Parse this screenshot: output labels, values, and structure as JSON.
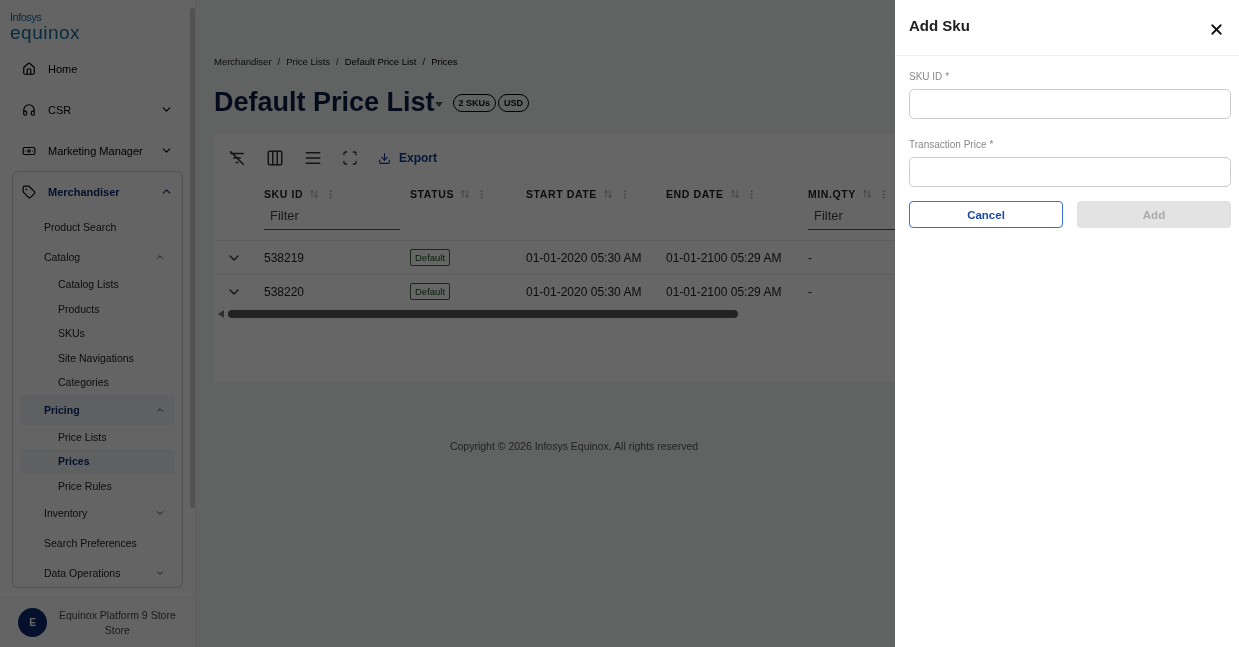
{
  "logo": {
    "top": "Infosys",
    "bottom": "equinox"
  },
  "sidebar": {
    "items": [
      {
        "label": "Home",
        "selected": false
      },
      {
        "label": "CSR",
        "expanded": false,
        "selected": false
      },
      {
        "label": "Marketing Manager",
        "expanded": false,
        "selected": false
      },
      {
        "label": "Merchandiser",
        "expanded": true,
        "selected": true,
        "children": [
          {
            "label": "Product Search",
            "selected": false
          },
          {
            "label": "Catalog",
            "expanded": true,
            "selected": false,
            "children": [
              {
                "label": "Catalog Lists",
                "selected": false
              },
              {
                "label": "Products",
                "selected": false
              },
              {
                "label": "SKUs",
                "selected": false
              },
              {
                "label": "Site Navigations",
                "selected": false
              },
              {
                "label": "Categories",
                "selected": false
              }
            ]
          },
          {
            "label": "Pricing",
            "expanded": true,
            "selected": true,
            "children": [
              {
                "label": "Price Lists",
                "selected": false
              },
              {
                "label": "Prices",
                "selected": true
              },
              {
                "label": "Price Rules",
                "selected": false
              }
            ]
          },
          {
            "label": "Inventory",
            "expanded": false,
            "selected": false
          },
          {
            "label": "Search Preferences",
            "selected": false
          },
          {
            "label": "Data Operations",
            "expanded": false,
            "selected": false
          }
        ]
      }
    ],
    "footer": {
      "avatar": "E",
      "name": "Equinox Platform 9 Store",
      "role": "Store"
    }
  },
  "breadcrumb": [
    {
      "kind": "link",
      "label": "Merchandiser"
    },
    {
      "kind": "separator",
      "label": "/"
    },
    {
      "kind": "link",
      "label": "Price Lists"
    },
    {
      "kind": "separator",
      "label": "/"
    },
    {
      "kind": "current",
      "label": "Default Price List"
    },
    {
      "kind": "separator",
      "label": "/"
    },
    {
      "kind": "current",
      "label": "Prices"
    }
  ],
  "header": {
    "title": "Default Price List",
    "badges": [
      "2 SKUs",
      "USD"
    ]
  },
  "toolbar": {
    "export": "Export"
  },
  "table": {
    "columns": [
      {
        "label": "SKU ID",
        "placeholder": "Filter"
      },
      {
        "label": "STATUS"
      },
      {
        "label": "START DATE"
      },
      {
        "label": "END DATE"
      },
      {
        "label": "MIN.QTY",
        "placeholder": "Filter"
      }
    ],
    "rows": [
      {
        "expanded": false,
        "cells": [
          "538219",
          "Default",
          "01-01-2020 05:30 AM",
          "01-01-2100 05:29 AM",
          "-"
        ]
      },
      {
        "expanded": false,
        "cells": [
          "538220",
          "Default",
          "01-01-2020 05:30 AM",
          "01-01-2100 05:29 AM",
          "-"
        ]
      }
    ]
  },
  "copyright": "Copyright © 2026 Infosys Equinox. All rights reserved",
  "drawer": {
    "title": "Add Sku",
    "fields": [
      {
        "label": "SKU ID",
        "required_mark": "*"
      },
      {
        "label": "Transaction Price",
        "required_mark": "*"
      }
    ],
    "buttons": [
      {
        "label": "Cancel",
        "kind": "secondary",
        "disabled": false
      },
      {
        "label": "Add",
        "kind": "primary",
        "disabled": true
      }
    ]
  }
}
